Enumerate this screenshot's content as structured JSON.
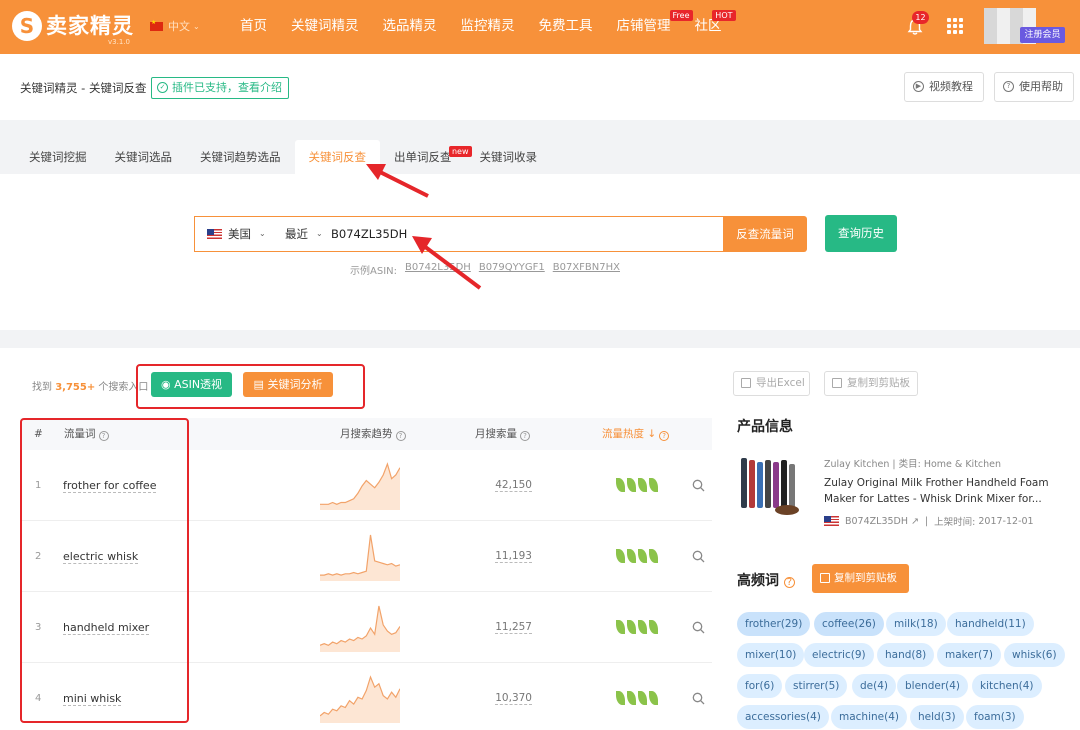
{
  "topbar": {
    "logo_mark": "S",
    "logo_text": "卖家精灵",
    "logo_version": "v3.1.0",
    "language": "中文",
    "nav": [
      {
        "label": "首页"
      },
      {
        "label": "关键词精灵"
      },
      {
        "label": "选品精灵"
      },
      {
        "label": "监控精灵"
      },
      {
        "label": "免费工具"
      },
      {
        "label": "店铺管理",
        "badge": "Free"
      },
      {
        "label": "社区",
        "badge": "HOT"
      }
    ],
    "notifications": "12",
    "vip_label": "注册会员"
  },
  "title_bar": {
    "title": "关键词精灵 - 关键词反查",
    "plugin_tag": "插件已支持，查看介绍",
    "video_tutorial": "视频教程",
    "help": "使用帮助"
  },
  "tabs": [
    {
      "label": "关键词挖掘"
    },
    {
      "label": "关键词选品"
    },
    {
      "label": "关键词趋势选品"
    },
    {
      "label": "关键词反查"
    },
    {
      "label": "出单词反查",
      "badge": "new"
    },
    {
      "label": "关键词收录"
    }
  ],
  "search": {
    "country": "美国",
    "period": "最近",
    "asin_value": "B074ZL35DH",
    "reverse_button": "反查流量词",
    "history_button": "查询历史",
    "example_label": "示例ASIN:",
    "examples": [
      "B0742L35DH",
      "B079QYYGF1",
      "B07XFBN7HX"
    ]
  },
  "results": {
    "found_prefix": "找到",
    "found_count": "3,755+",
    "found_suffix": "个搜索入口",
    "asin_view_button": "ASIN透视",
    "keyword_analysis_button": "关键词分析",
    "columns": {
      "index": "#",
      "keyword": "流量词",
      "trend": "月搜索趋势",
      "volume": "月搜索量",
      "hotness": "流量热度"
    },
    "rows": [
      {
        "index": "1",
        "keyword": "frother for coffee",
        "volume": "42,150",
        "trend": [
          2,
          2,
          2,
          3,
          2,
          3,
          3,
          4,
          5,
          8,
          12,
          15,
          13,
          11,
          14,
          18,
          24,
          16,
          18,
          22
        ]
      },
      {
        "index": "2",
        "keyword": "electric whisk",
        "volume": "11,193",
        "trend": [
          3,
          3,
          4,
          3,
          4,
          3,
          4,
          4,
          5,
          4,
          5,
          6,
          34,
          14,
          13,
          12,
          11,
          12,
          10,
          11
        ]
      },
      {
        "index": "3",
        "keyword": "handheld mixer",
        "volume": "11,257",
        "trend": [
          3,
          4,
          3,
          5,
          4,
          6,
          5,
          7,
          6,
          8,
          7,
          9,
          14,
          10,
          28,
          16,
          12,
          10,
          11,
          15
        ]
      },
      {
        "index": "4",
        "keyword": "mini whisk",
        "volume": "10,370",
        "trend": [
          3,
          5,
          4,
          7,
          6,
          9,
          8,
          12,
          10,
          14,
          13,
          18,
          26,
          20,
          22,
          15,
          13,
          17,
          14,
          19
        ]
      }
    ]
  },
  "right_panel": {
    "export_button": "导出Excel",
    "copy_button": "复制到剪贴板",
    "product_info_title": "产品信息",
    "brand": "Zulay Kitchen",
    "category_label": "类目:",
    "category": "Home & Kitchen",
    "product_title": "Zulay Original Milk Frother Handheld Foam Maker for Lattes - Whisk Drink Mixer for...",
    "asin": "B074ZL35DH",
    "launch_label": "上架时间:",
    "launch_date": "2017-12-01",
    "high_freq_title": "高频词",
    "high_freq_copy": "复制到剪贴板",
    "words": [
      "frother(29)",
      "coffee(26)",
      "milk(18)",
      "handheld(11)",
      "mixer(10)",
      "electric(9)",
      "hand(8)",
      "maker(7)",
      "whisk(6)",
      "for(6)",
      "stirrer(5)",
      "de(4)",
      "blender(4)",
      "kitchen(4)",
      "accessories(4)",
      "machine(4)",
      "held(3)",
      "foam(3)"
    ]
  }
}
